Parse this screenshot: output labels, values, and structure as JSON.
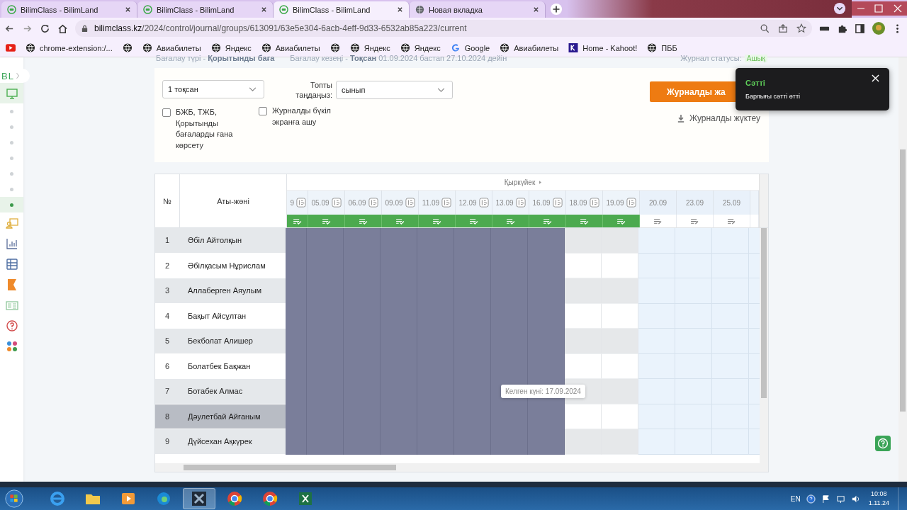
{
  "browser": {
    "tabs": [
      {
        "title": "BilimClass - BilimLand",
        "kind": "site",
        "selected": false
      },
      {
        "title": "BilimClass - BilimLand",
        "kind": "site",
        "selected": false
      },
      {
        "title": "BilimClass - BilimLand",
        "kind": "site",
        "selected": true
      },
      {
        "title": "Новая вкладка",
        "kind": "globe",
        "selected": false
      }
    ],
    "url_host": "bilimclass.kz",
    "url_path": "/2024/control/journal/groups/613091/63e5e304-6acb-4eff-9d33-6532ab85a223/current",
    "bookmarks": [
      {
        "kind": "youtube"
      },
      {
        "kind": "globe",
        "label": "chrome-extension:/..."
      },
      {
        "kind": "globe"
      },
      {
        "kind": "globe",
        "label": "Авиабилеты"
      },
      {
        "kind": "globe",
        "label": "Яндекс"
      },
      {
        "kind": "globe",
        "label": "Авиабилеты"
      },
      {
        "kind": "globe"
      },
      {
        "kind": "globe",
        "label": "Яндекс"
      },
      {
        "kind": "globe",
        "label": "Яндекс"
      },
      {
        "kind": "google",
        "label": "Google"
      },
      {
        "kind": "globe",
        "label": "Авиабилеты"
      },
      {
        "kind": "kahoot",
        "label": "Home - Kahoot!"
      },
      {
        "kind": "globe",
        "label": "ПББ"
      }
    ]
  },
  "sidebar": {
    "logo": "BL",
    "items": [
      {
        "kind": "monitor",
        "selected": true
      },
      {
        "kind": "dot",
        "selected": false
      },
      {
        "kind": "dot",
        "selected": false
      },
      {
        "kind": "dot",
        "selected": false
      },
      {
        "kind": "dot",
        "selected": false
      },
      {
        "kind": "dot",
        "selected": false
      },
      {
        "kind": "dot",
        "selected": false
      },
      {
        "kind": "dot",
        "selected": true
      },
      {
        "kind": "board",
        "selected": false
      },
      {
        "kind": "chart",
        "selected": false
      },
      {
        "kind": "table",
        "selected": false
      },
      {
        "kind": "flag",
        "selected": false
      },
      {
        "kind": "card",
        "selected": false
      },
      {
        "kind": "help",
        "selected": false
      },
      {
        "kind": "apps",
        "selected": false
      }
    ]
  },
  "info": {
    "grade_type": "Бағалау түрі - **Қорытынды баға**",
    "period": "Бағалау кезеңі - **Тоқсан** 01.09.2024 бастап 27.10.2024 дейін",
    "status_label": "Журнал статусы:",
    "status": "Ашық"
  },
  "filters": {
    "quarter": "1 тоқсан",
    "group_label": "Топты таңдаңыз:",
    "group": "сынып",
    "checkboxes": [
      {
        "label": "БЖБ, ТЖБ, Қорытынды бағаларды ғана көрсету",
        "checked": false
      },
      {
        "label": "Журналды бүкіл экранға ашу",
        "checked": false
      }
    ],
    "primary_button": "Журналды жа",
    "download": "Журналды жүктеу"
  },
  "toast": {
    "title": "Сәтті",
    "message": "Барлығы сәтті өтті"
  },
  "table": {
    "number_heading": "№",
    "name_heading": "Аты-жөні",
    "month": "Қыркүйек",
    "columns": [
      {
        "date": "9",
        "kind": "closed"
      },
      {
        "date": "05.09",
        "kind": "closed"
      },
      {
        "date": "06.09",
        "kind": "closed"
      },
      {
        "date": "09.09",
        "kind": "closed"
      },
      {
        "date": "11.09",
        "kind": "closed"
      },
      {
        "date": "12.09",
        "kind": "closed"
      },
      {
        "date": "13.09",
        "kind": "closed"
      },
      {
        "date": "16.09",
        "kind": "closed"
      },
      {
        "date": "18.09",
        "kind": "done"
      },
      {
        "date": "19.09",
        "kind": "done"
      },
      {
        "date": "20.09",
        "kind": "open"
      },
      {
        "date": "23.09",
        "kind": "open"
      },
      {
        "date": "25.09",
        "kind": "open"
      }
    ],
    "rows": [
      {
        "number": "1",
        "name": "Әбіл Айтолқын",
        "selected": false
      },
      {
        "number": "2",
        "name": "Әбілқасым Нұрислам",
        "selected": false
      },
      {
        "number": "3",
        "name": "Аллаберген Аяулым",
        "selected": false
      },
      {
        "number": "4",
        "name": "Бақыт Айсұлтан",
        "selected": false
      },
      {
        "number": "5",
        "name": "Бекболат Алишер",
        "selected": false
      },
      {
        "number": "6",
        "name": "Болатбек Бақжан",
        "selected": false
      },
      {
        "number": "7",
        "name": "Ботабек Алмас",
        "selected": false
      },
      {
        "number": "8",
        "name": "Дәулетбай Айғаным",
        "selected": true
      },
      {
        "number": "9",
        "name": "Дүйсехан Ақкүрек",
        "selected": false
      }
    ],
    "tooltip": "Келген күні: 17.09.2024"
  },
  "taskbar": {
    "apps": [
      {
        "kind": "ie",
        "active": false
      },
      {
        "kind": "folder",
        "active": false
      },
      {
        "kind": "media",
        "active": false
      },
      {
        "kind": "edge",
        "active": false
      },
      {
        "kind": "tool",
        "active": true
      },
      {
        "kind": "chrome",
        "active": false
      },
      {
        "kind": "chrome",
        "active": false
      },
      {
        "kind": "excel",
        "active": false
      }
    ],
    "language": "EN",
    "time": "10:08",
    "date": "1.11.24"
  }
}
